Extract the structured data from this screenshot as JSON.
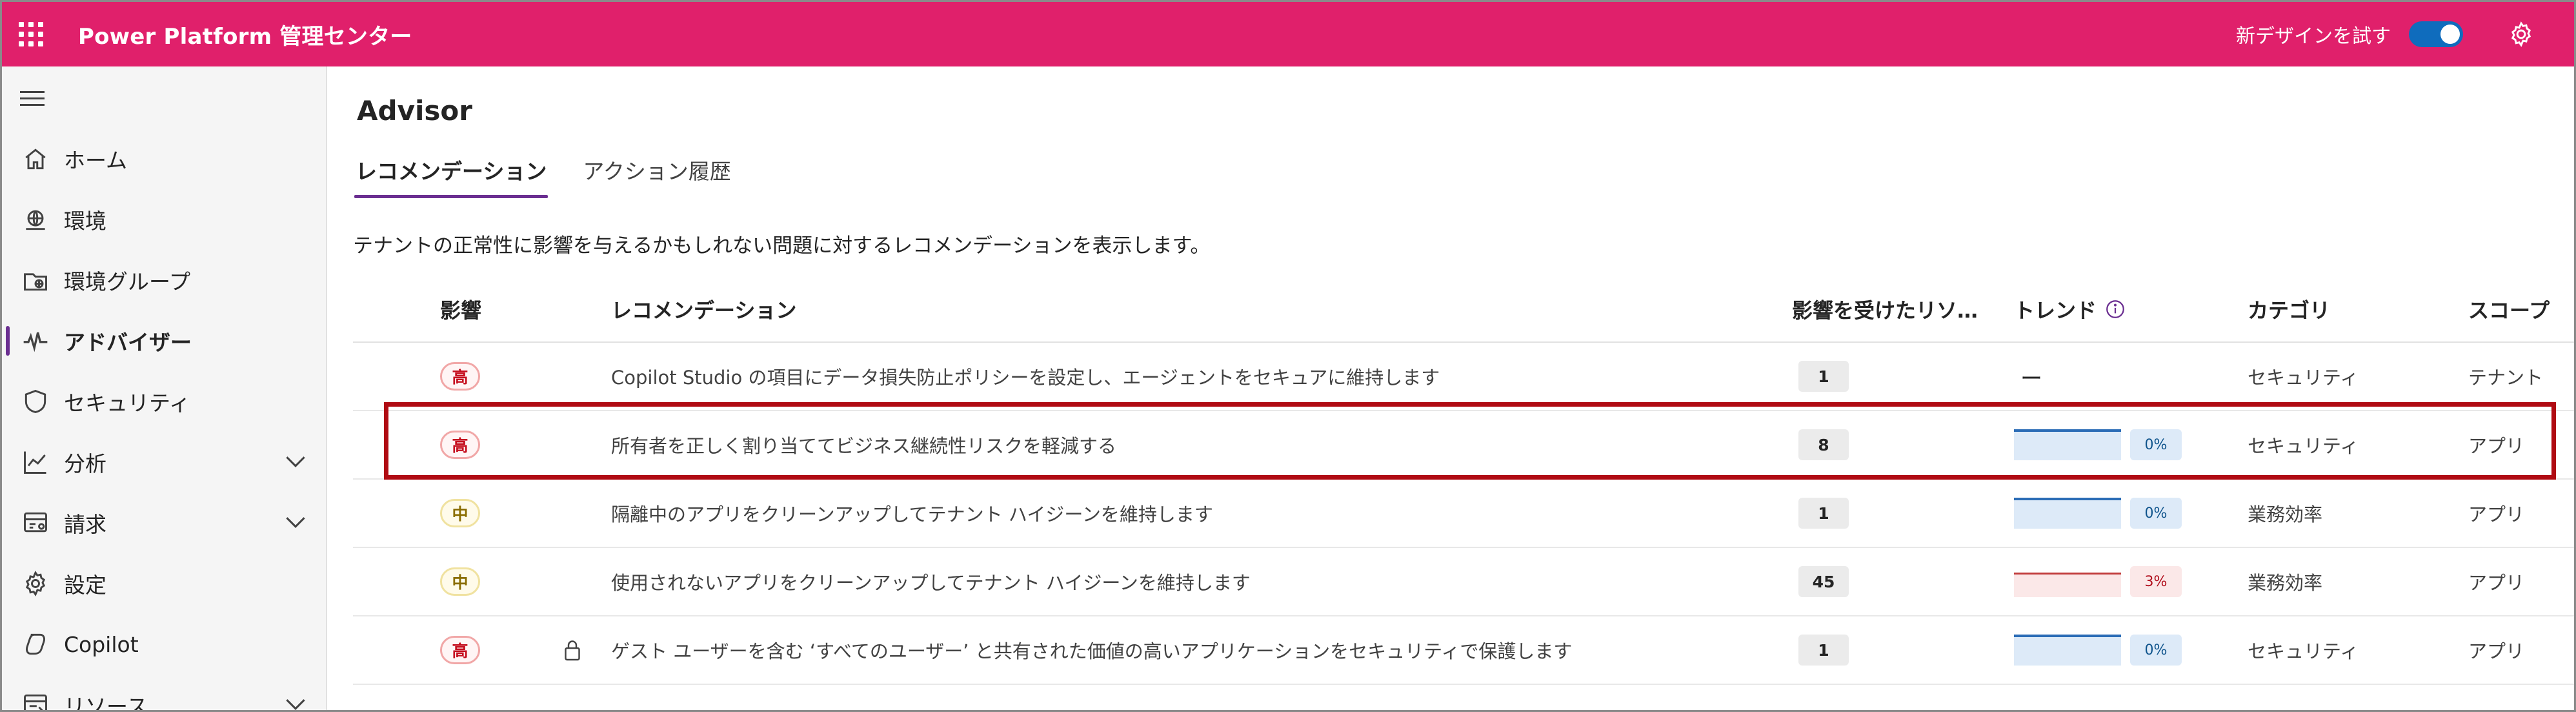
{
  "app": {
    "title": "Power Platform 管理センター",
    "new_design_label": "新デザインを試す",
    "new_design_enabled": true
  },
  "sidebar": {
    "items": [
      {
        "label": "ホーム",
        "icon": "home-icon"
      },
      {
        "label": "環境",
        "icon": "environment-icon"
      },
      {
        "label": "環境グループ",
        "icon": "environment-group-icon"
      },
      {
        "label": "アドバイザー",
        "icon": "advisor-icon",
        "active": true
      },
      {
        "label": "セキュリティ",
        "icon": "shield-icon"
      },
      {
        "label": "分析",
        "icon": "analytics-icon",
        "expandable": true
      },
      {
        "label": "請求",
        "icon": "billing-icon",
        "expandable": true
      },
      {
        "label": "設定",
        "icon": "settings-icon"
      },
      {
        "label": "Copilot",
        "icon": "copilot-icon"
      },
      {
        "label": "リソース",
        "icon": "resources-icon",
        "expandable": true
      }
    ]
  },
  "main": {
    "title": "Advisor",
    "tabs": [
      {
        "label": "レコメンデーション",
        "active": true
      },
      {
        "label": "アクション履歴",
        "active": false
      }
    ],
    "description": "テナントの正常性に影響を与えるかもしれない問題に対するレコメンデーションを表示します。",
    "columns": {
      "impact": "影響",
      "recommendation": "レコメンデーション",
      "affected_resources": "影響を受けたリソ…",
      "trend": "トレンド",
      "category": "カテゴリ",
      "scope": "スコープ"
    },
    "rows": [
      {
        "impact": "高",
        "level": "high",
        "locked": false,
        "recommendation": "Copilot Studio の項目にデータ損失防止ポリシーを設定し、エージェントをセキュアに維持します",
        "count": "1",
        "trend_text": "ー",
        "trend_pct": "",
        "trend_color": "none",
        "category": "セキュリティ",
        "scope": "テナント"
      },
      {
        "impact": "高",
        "level": "high",
        "locked": false,
        "recommendation": "所有者を正しく割り当ててビジネス継続性リスクを軽減する",
        "count": "8",
        "trend_text": "",
        "trend_pct": "0%",
        "trend_color": "blue",
        "category": "セキュリティ",
        "scope": "アプリ",
        "highlighted": true
      },
      {
        "impact": "中",
        "level": "medium",
        "locked": false,
        "recommendation": "隔離中のアプリをクリーンアップしてテナント ハイジーンを維持します",
        "count": "1",
        "trend_text": "",
        "trend_pct": "0%",
        "trend_color": "blue",
        "category": "業務効率",
        "scope": "アプリ"
      },
      {
        "impact": "中",
        "level": "medium",
        "locked": false,
        "recommendation": "使用されないアプリをクリーンアップしてテナント ハイジーンを維持します",
        "count": "45",
        "trend_text": "",
        "trend_pct": "3%",
        "trend_color": "red",
        "category": "業務効率",
        "scope": "アプリ"
      },
      {
        "impact": "高",
        "level": "high",
        "locked": true,
        "recommendation": "ゲスト ユーザーを含む ‘すべてのユーザー’ と共有された価値の高いアプリケーションをセキュリティで保護します",
        "count": "1",
        "trend_text": "",
        "trend_pct": "0%",
        "trend_color": "blue",
        "category": "セキュリティ",
        "scope": "アプリ"
      }
    ]
  },
  "colors": {
    "brand_bar": "#e0206b",
    "accent": "#6b2f91",
    "highlight_box": "#b00b13",
    "toggle_on": "#0f6cbd"
  }
}
